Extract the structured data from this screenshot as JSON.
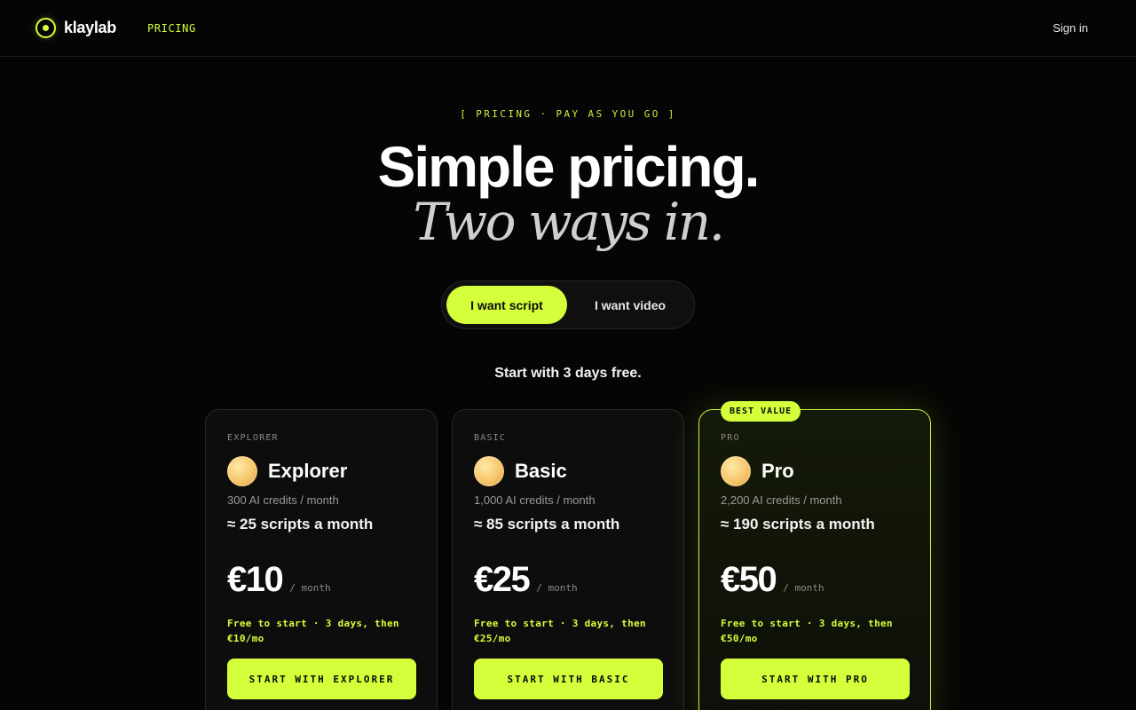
{
  "header": {
    "logo_text": "klaylab",
    "nav_pricing": "PRICING",
    "sign_in": "Sign in"
  },
  "hero": {
    "eyebrow": "[ PRICING · PAY AS YOU GO ]",
    "title": "Simple pricing.",
    "subtitle": "Two ways in.",
    "toggle": {
      "option_script": "I want script",
      "option_video": "I want video",
      "selected": "I want script"
    },
    "trial_note": "Start with 3 days free."
  },
  "plans": [
    {
      "tier": "EXPLORER",
      "name": "Explorer",
      "credits": "300 AI credits / month",
      "scripts": "≈ 25 scripts a month",
      "price": "€10",
      "per": "/ month",
      "trial": "Free to start · 3 days, then €10/mo",
      "cta": "START WITH EXPLORER"
    },
    {
      "tier": "BASIC",
      "name": "Basic",
      "credits": "1,000 AI credits / month",
      "scripts": "≈ 85 scripts a month",
      "price": "€25",
      "per": "/ month",
      "trial": "Free to start · 3 days, then €25/mo",
      "cta": "START WITH BASIC"
    },
    {
      "badge": "BEST VALUE",
      "tier": "PRO",
      "name": "Pro",
      "credits": "2,200 AI credits / month",
      "scripts": "≈ 190 scripts a month",
      "price": "€50",
      "per": "/ month",
      "trial": "Free to start · 3 days, then €50/mo",
      "cta": "START WITH PRO"
    }
  ],
  "colors": {
    "accent": "#d4ff3a",
    "background": "#050505",
    "card": "#0d0d0d"
  },
  "icons": {
    "logo": "ring-dot-logo-icon",
    "plan": "coin-icon"
  }
}
